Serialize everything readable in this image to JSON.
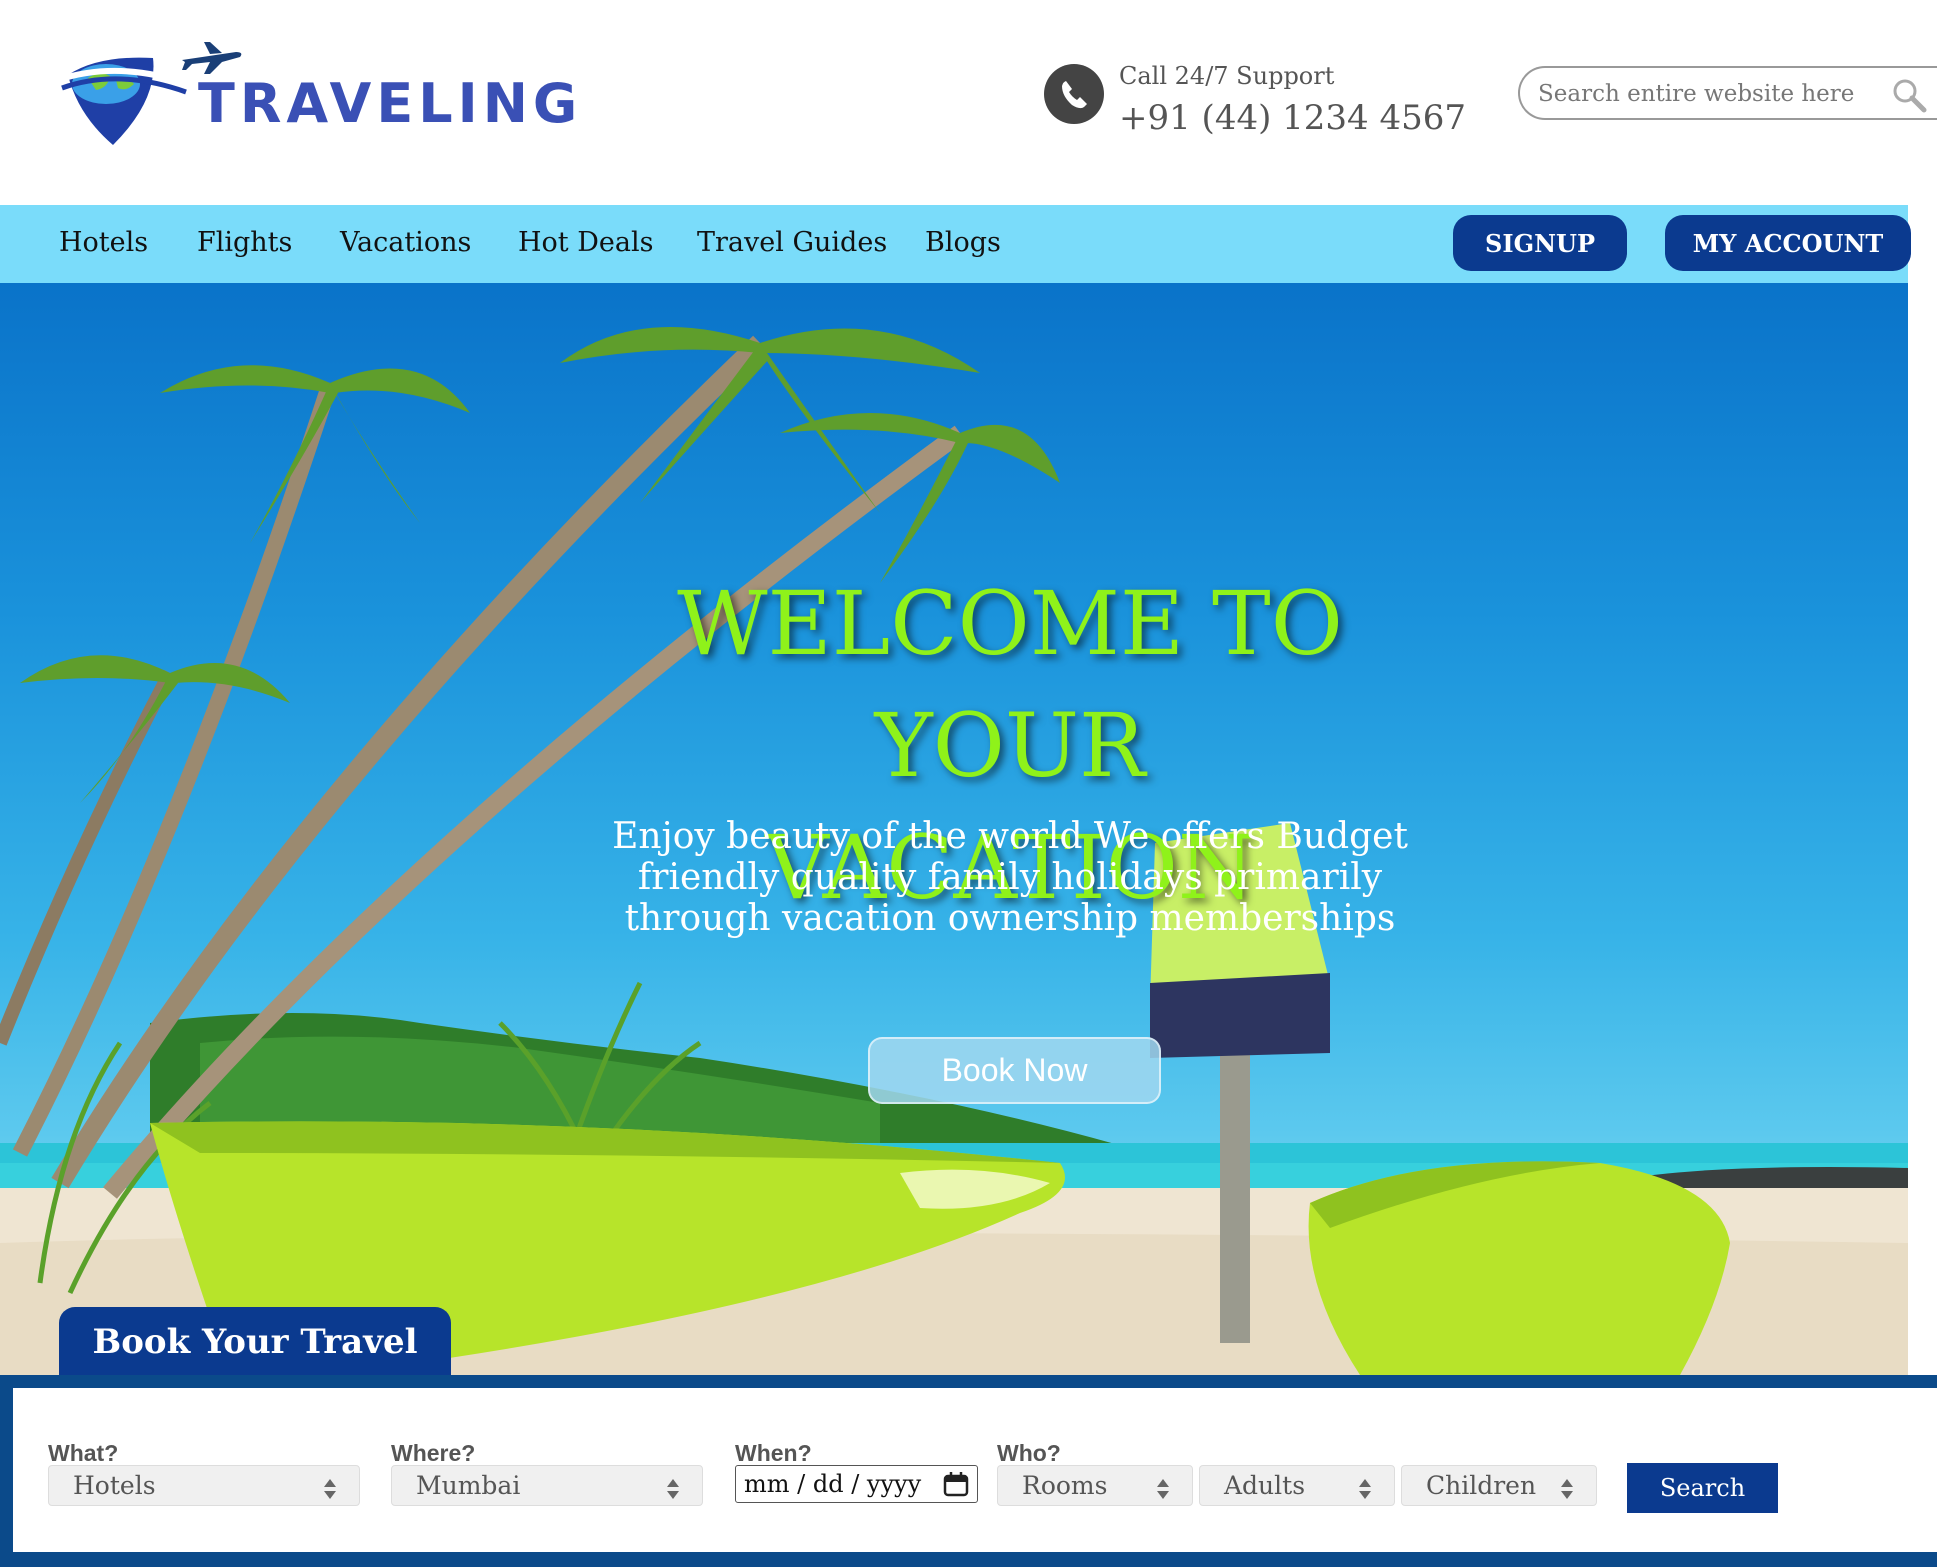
{
  "brand": {
    "logo_text": "TRAVELING",
    "primary_color": "#0b3a8f",
    "nav_color": "#7adcfa",
    "headline_color": "#8ff21a"
  },
  "header": {
    "support_label": "Call 24/7 Support",
    "support_phone": "+91 (44) 1234 4567",
    "search_placeholder": "Search entire website here"
  },
  "nav": {
    "items": [
      "Hotels",
      "Flights",
      "Vacations",
      "Hot Deals",
      "Travel Guides",
      "Blogs"
    ],
    "signup_label": "SIGNUP",
    "account_label": "MY ACCOUNT"
  },
  "hero": {
    "title_line1": "WELCOME TO YOUR",
    "title_line2": "VACATION",
    "subtitle": "Enjoy beauty of the world We offers Budget friendly quality family holidays primarily through vacation ownership memberships",
    "cta_label": "Book Now"
  },
  "booking": {
    "tab_label": "Book Your Travel",
    "what_label": "What?",
    "what_value": "Hotels",
    "where_label": "Where?",
    "where_value": "Mumbai",
    "when_label": "When?",
    "when_value": "mm / dd / yyyy",
    "who_label": "Who?",
    "rooms_value": "Rooms",
    "adults_value": "Adults",
    "children_value": "Children",
    "search_label": "Search"
  },
  "icons": [
    "globe-logo-icon",
    "plane-icon",
    "phone-icon",
    "search-icon",
    "calendar-icon",
    "spinner-arrows-icon"
  ]
}
